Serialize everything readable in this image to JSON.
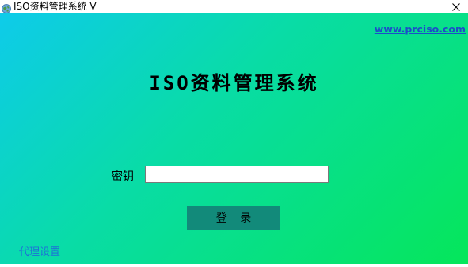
{
  "window": {
    "title": "ISO资料管理系统 V",
    "app_icon": "globe-icon",
    "close_icon": "close-icon"
  },
  "header": {
    "website_link": "www.prciso.com"
  },
  "main": {
    "title": "ISO资料管理系统"
  },
  "login_form": {
    "key_label": "密钥",
    "key_value": "",
    "key_placeholder": "",
    "login_button": "登 录"
  },
  "footer": {
    "proxy_settings_link": "代理设置"
  },
  "colors": {
    "gradient_start": "#0ecbea",
    "gradient_end": "#05e65a",
    "button_bg": "#128a7a",
    "link_blue": "#1b4fc9"
  }
}
